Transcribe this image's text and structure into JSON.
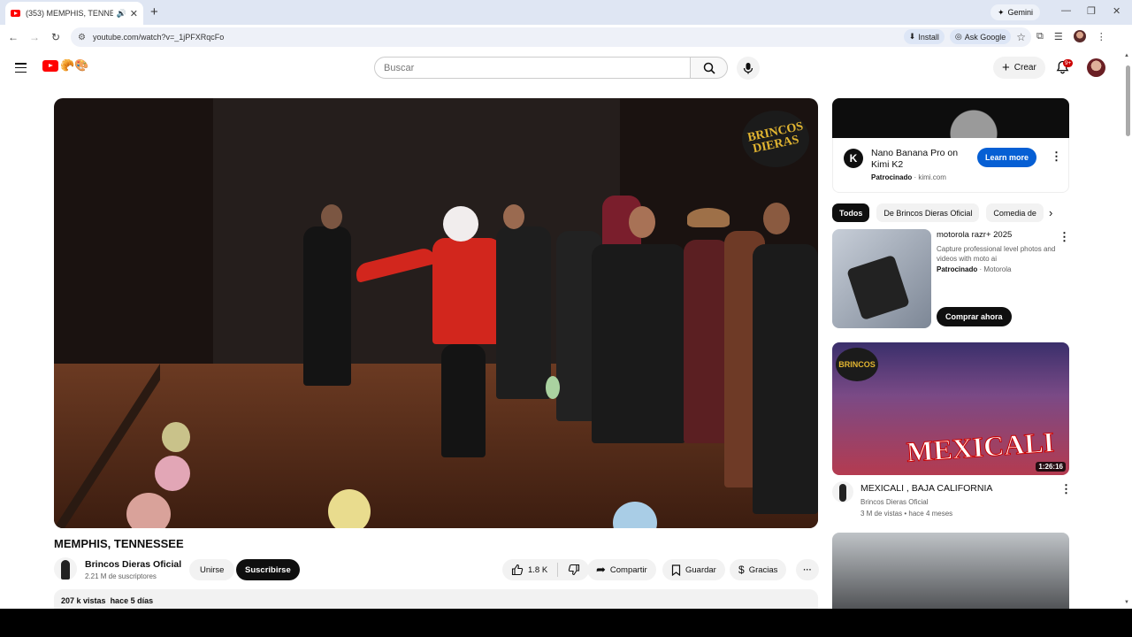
{
  "browser": {
    "tab_title": "(353) MEMPHIS, TENNESSE",
    "new_tab": "+",
    "gemini_label": "Gemini",
    "url": "youtube.com/watch?v=_1jPFXRqcFo",
    "install_label": "Install",
    "ask_google_label": "Ask Google"
  },
  "header": {
    "search_placeholder": "Buscar",
    "create_label": "Crear",
    "notifications_badge": "9+"
  },
  "video": {
    "title": "MEMPHIS, TENNESSEE",
    "watermark_line1": "BRINCOS",
    "watermark_line2": "DIERAS",
    "channel_name": "Brincos Dieras Oficial",
    "subscribers": "2.21 M de suscriptores",
    "join_label": "Unirse",
    "subscribe_label": "Suscribirse",
    "likes": "1.8 K",
    "share_label": "Compartir",
    "save_label": "Guardar",
    "thanks_label": "Gracias",
    "views": "207 k vistas",
    "age": "hace 5 días"
  },
  "sidebar": {
    "ad": {
      "title": "Nano Banana Pro on Kimi K2",
      "sponsored": "Patrocinado",
      "domain": "kimi.com",
      "cta": "Learn more",
      "logo_letter": "K"
    },
    "chips": [
      "Todos",
      "De Brincos Dieras Oficial",
      "Comedia de"
    ],
    "promo": {
      "title": "motorola razr+ 2025",
      "description": "Capture professional level photos and videos with moto ai",
      "sponsored": "Patrocinado",
      "advertiser": "Motorola",
      "cta": "Comprar ahora"
    },
    "recommended": {
      "thumb_text": "MEXICALI",
      "thumb_logo": "BRINCOS",
      "duration": "1:26:16",
      "title": "MEXICALI , BAJA CALIFORNIA",
      "channel": "Brincos Dieras Oficial",
      "meta": "3 M de vistas • hace 4 meses"
    }
  }
}
